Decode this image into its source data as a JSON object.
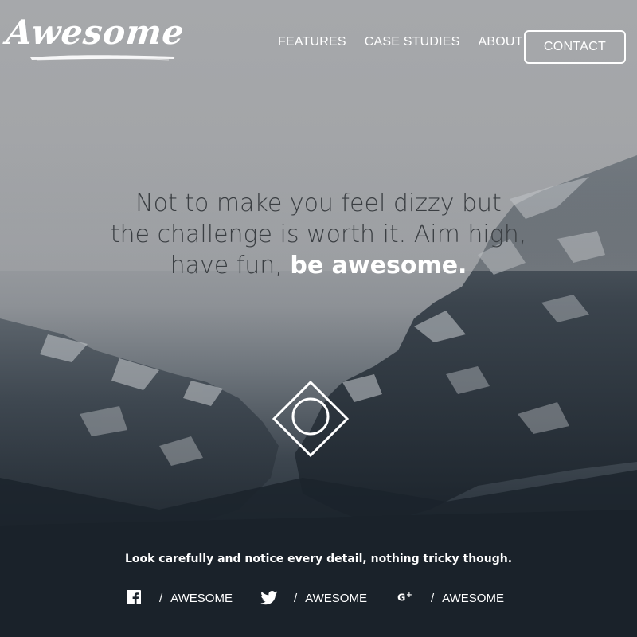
{
  "header": {
    "logo_text": "Awesome",
    "nav": [
      {
        "label": "FEATURES"
      },
      {
        "label": "CASE STUDIES"
      },
      {
        "label": "ABOUT"
      }
    ],
    "contact_label": "CONTACT"
  },
  "hero": {
    "line1": "Not to make you feel dizzy but",
    "line2": "the challenge is worth it. Aim high,",
    "line3_regular": "have fun,",
    "line3_bold": "be awesome."
  },
  "tagline": "Look carefully and notice every detail, nothing tricky though.",
  "socials": [
    {
      "icon": "facebook-icon",
      "separator": "/",
      "label": "AWESOME"
    },
    {
      "icon": "twitter-icon",
      "separator": "/",
      "label": "AWESOME"
    },
    {
      "icon": "google-plus-icon",
      "separator": "/",
      "label": "AWESOME"
    }
  ],
  "colors": {
    "text_dark": "#3a3e42",
    "text_light": "#ffffff",
    "background_dark": "#1b232b"
  }
}
